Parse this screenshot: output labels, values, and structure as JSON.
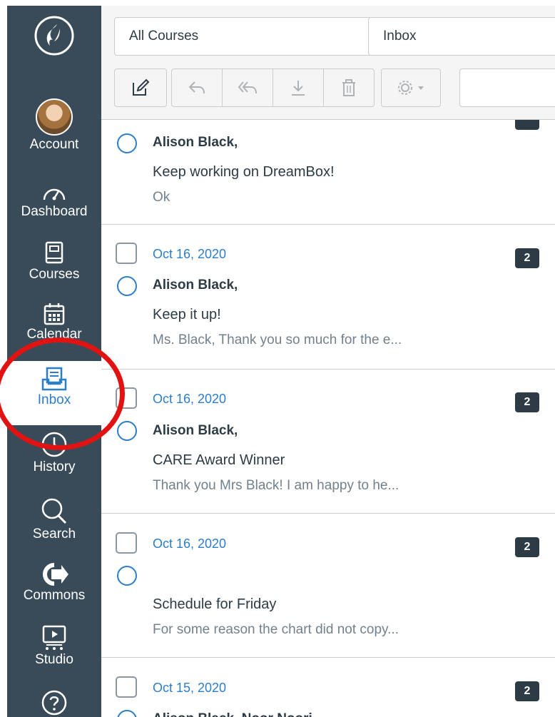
{
  "nav": {
    "account": "Account",
    "dashboard": "Dashboard",
    "courses": "Courses",
    "calendar": "Calendar",
    "inbox": "Inbox",
    "history": "History",
    "search": "Search",
    "commons": "Commons",
    "studio": "Studio",
    "active_color": "#2D7EC7",
    "background": "#394B58"
  },
  "toolbar": {
    "course_filter": "All Courses",
    "box_filter": "Inbox"
  },
  "messages": [
    {
      "sender": "Alison Black,",
      "subject": "Keep working on DreamBox!",
      "preview": "Ok"
    },
    {
      "date": "Oct 16, 2020",
      "count": "2",
      "sender": "Alison Black,",
      "subject": "Keep it up!",
      "preview": "Ms. Black, Thank you so much for the e..."
    },
    {
      "date": "Oct 16, 2020",
      "count": "2",
      "sender": "Alison Black,",
      "subject": "CARE Award Winner",
      "preview": "Thank you Mrs Black! I am happy to he..."
    },
    {
      "date": "Oct 16, 2020",
      "count": "2",
      "sender": "",
      "subject": "Schedule for Friday",
      "preview": "For some reason the chart did not copy..."
    },
    {
      "date": "Oct 15, 2020",
      "count": "2",
      "sender": "Alison Black, Noor Noori",
      "subject": "",
      "preview": ""
    }
  ],
  "annotation_color": "#E01212"
}
